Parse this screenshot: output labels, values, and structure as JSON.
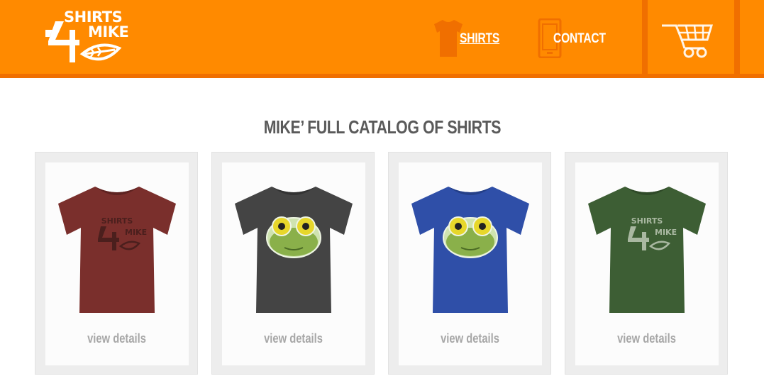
{
  "brand": {
    "logo_line1": "SHIRTS",
    "logo_line2": "MIKE",
    "logo_digit": "4"
  },
  "nav": {
    "items": [
      {
        "label": "SHIRTS",
        "icon": "tshirt-icon",
        "active": true
      },
      {
        "label": "CONTACT",
        "icon": "phone-icon",
        "active": false
      }
    ],
    "cart_icon": "cart-icon"
  },
  "colors": {
    "header": "#ff8a00",
    "header_dark": "#f06f00",
    "text_heading": "#5a5a5a",
    "text_link": "#a7a7a7"
  },
  "catalog": {
    "title": "MIKE’ FULL CATALOG OF SHIRTS",
    "products": [
      {
        "color": "#7a2f2c",
        "graphic": "logo",
        "cta": "view details"
      },
      {
        "color": "#444444",
        "graphic": "frog",
        "cta": "view details"
      },
      {
        "color": "#2f4fa8",
        "graphic": "frog",
        "cta": "view details"
      },
      {
        "color": "#3d5e34",
        "graphic": "logo",
        "cta": "view details"
      }
    ]
  }
}
